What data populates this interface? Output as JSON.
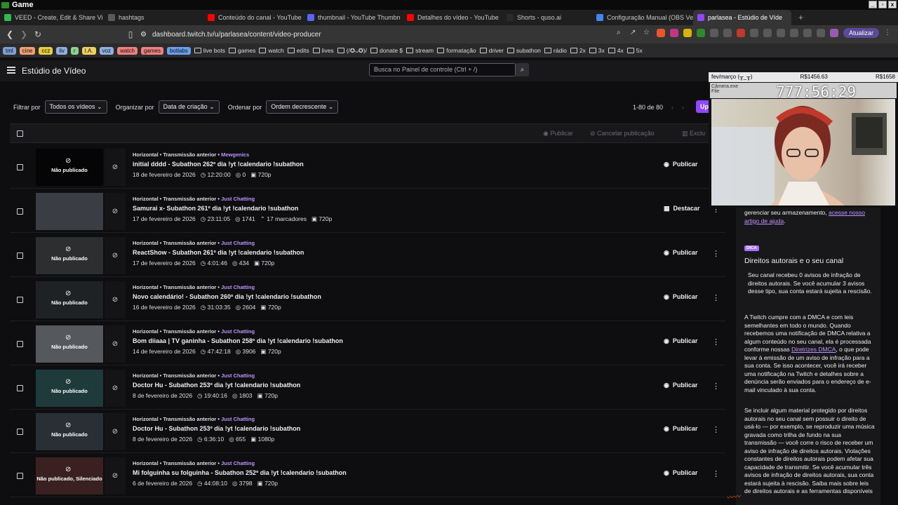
{
  "os": {
    "title": "Game"
  },
  "browser": {
    "tabs": [
      {
        "label": "VEED - Create, Edit & Share Vi",
        "color": "#2dbb4e"
      },
      {
        "label": "hashtags",
        "color": "#5a5a5a"
      },
      {
        "label": "Conteúdo do canal - YouTube",
        "color": "#ff0000"
      },
      {
        "label": "thumbnail - YouTube Thumbn",
        "color": "#5865f2"
      },
      {
        "label": "Detalhes do vídeo - YouTube",
        "color": "#ff0000"
      },
      {
        "label": "Shorts - quso.ai",
        "color": "#2a2a2a"
      },
      {
        "label": "Configuração Manual (OBS Ve",
        "color": "#4285f4"
      },
      {
        "label": "parlasea - Estúdio de Víde",
        "color": "#9147ff"
      }
    ],
    "url": "dashboard.twitch.tv/u/parlasea/content/video-producer",
    "update_label": "Atualizar",
    "bookmarks": [
      {
        "label": "tml",
        "color": "#7d9fd6"
      },
      {
        "label": "cine",
        "color": "#f0a070"
      },
      {
        "label": "ccz",
        "color": "#e8cc40"
      },
      {
        "label": "liv",
        "color": "#8db0e0"
      },
      {
        "label": "r",
        "color": "#8fd08f"
      },
      {
        "label": "I.A.",
        "color": "#f0d060"
      },
      {
        "label": "voz",
        "color": "#8fb0e0"
      },
      {
        "label": "watch",
        "color": "#f08080"
      },
      {
        "label": "games",
        "color": "#f08080"
      },
      {
        "label": "botlabs",
        "color": "#6aa0f0"
      }
    ],
    "folders": [
      "live bots",
      "games",
      "watch",
      "edits",
      "lives",
      "(/✪ᴗ✪)/",
      "donate $",
      "stream",
      "formatação",
      "driver",
      "subathon",
      "rádio",
      "2x",
      "3x",
      "4x",
      "5x"
    ]
  },
  "studio": {
    "title": "Estúdio de Vídeo",
    "search_placeholder": "Busca no Painel de controle (Ctrl + /)",
    "filter_label": "Filtrar por",
    "filter_value": "Todos os vídeos",
    "organize_label": "Organizar por",
    "organize_value": "Data de criação",
    "order_label": "Ordenar por",
    "order_value": "Ordem decrescente",
    "pager": "1-80 de 80",
    "upload_label": "Upl",
    "bulk_publish": "Publicar",
    "bulk_unpublish": "Cancelar publicação",
    "bulk_delete": "Exclu"
  },
  "videos": [
    {
      "meta": "Horizontal • Transmissão anterior • ",
      "game": "Mewgenics",
      "title": "initial dddd - Subathon 262º dia !yt !calendario !subathon",
      "date": "18 de fevereiro de 2026",
      "duration": "12:20:00",
      "views": "0",
      "markers": "",
      "quality": "720p",
      "status": "Não publicado",
      "action": "Publicar"
    },
    {
      "meta": "Horizontal • Transmissão anterior • ",
      "game": "Just Chatting",
      "title": "Samurai x- Subathon 261º dia !yt !calendario !subathon",
      "date": "17 de fevereiro de 2026",
      "duration": "23:11:05",
      "views": "1741",
      "markers": "17 marcadores",
      "quality": "720p",
      "status": "",
      "action": "Destacar"
    },
    {
      "meta": "Horizontal • Transmissão anterior • ",
      "game": "Just Chatting",
      "title": "ReactShow - Subathon 261º dia !yt !calendario !subathon",
      "date": "17 de fevereiro de 2026",
      "duration": "4:01:46",
      "views": "434",
      "markers": "",
      "quality": "720p",
      "status": "Não publicado",
      "action": "Publicar"
    },
    {
      "meta": "Horizontal • Transmissão anterior • ",
      "game": "Just Chatting",
      "title": "Novo calendário! - Subathon 260º dia !yt !calendario !subathon",
      "date": "16 de fevereiro de 2026",
      "duration": "31:03:35",
      "views": "2604",
      "markers": "",
      "quality": "720p",
      "status": "Não publicado",
      "action": "Publicar"
    },
    {
      "meta": "Horizontal • Transmissão anterior • ",
      "game": "Just Chatting",
      "title": "Bom diiaaa | TV ganinha - Subathon 258º dia !yt !calendario !subathon",
      "date": "14 de fevereiro de 2026",
      "duration": "47:42:18",
      "views": "3906",
      "markers": "",
      "quality": "720p",
      "status": "Não publicado",
      "action": "Publicar"
    },
    {
      "meta": "Horizontal • Transmissão anterior • ",
      "game": "Just Chatting",
      "title": "Doctor Hu - Subathon 253º dia !yt !calendario !subathon",
      "date": "8 de fevereiro de 2026",
      "duration": "19:40:16",
      "views": "1803",
      "markers": "",
      "quality": "720p",
      "status": "Não publicado",
      "action": "Publicar"
    },
    {
      "meta": "Horizontal • Transmissão anterior • ",
      "game": "Just Chatting",
      "title": "Doctor Hu - Subathon 253º dia !yt !calendario !subathon",
      "date": "8 de fevereiro de 2026",
      "duration": "6:36:10",
      "views": "655",
      "markers": "",
      "quality": "1080p",
      "status": "Não publicado",
      "action": "Publicar"
    },
    {
      "meta": "Horizontal • Transmissão anterior • ",
      "game": "Just Chatting",
      "title": "Mi folguinha su folguinha - Subathon 252º dia !yt !calendario !subathon",
      "date": "6 de fevereiro de 2026",
      "duration": "44:08:10",
      "views": "3798",
      "markers": "",
      "quality": "720p",
      "status": "Não publicado, Silenciado",
      "action": "Publicar"
    }
  ],
  "panel": {
    "storage_text": "gerenciar seu armazenamento, ",
    "storage_link": "acesse nosso artigo de ajuda",
    "badge": "DICA",
    "heading": "Direitos autorais e o seu canal",
    "p1": "Seu canal recebeu 0 avisos de infração de direitos autorais. Se você acumular 3 avisos desse tipo, sua conta estará sujeita a rescisão.",
    "p2a": "A Twitch cumpre com a DMCA e com leis semelhantes em todo o mundo. Quando recebemos uma notificação de DMCA relativa a algum conteúdo no seu canal, ela é processada conforme nossas ",
    "p2link": "Diretrizes DMCA",
    "p2b": ", o que pode levar à emissão de um aviso de infração para a sua conta. Se isso acontecer, você irá receber uma notificação na Twitch e detalhes sobre a denúncia serão enviados para o endereço de e-mail vinculado à sua conta.",
    "p3": "Se incluir algum material protegido por direitos autorais no seu canal sem possuir o direito de usá-lo — por exemplo, se reproduzir uma música gravada como trilha de fundo na sua transmissão — você corre o risco de receber um aviso de infração de direitos autorais. Violações constantes de direitos autorais podem afetar sua capacidade de transmitir. Se você acumular três avisos de infração de direitos autorais, sua conta estará sujeita à rescisão. Saiba mais sobre leis de direitos autorais e as ferramentas disponíveis"
  },
  "overlay": {
    "title": "fev/março  (╥_╥)",
    "amount1": "R$1456.63",
    "amount2": "R$1658",
    "window_label": "Câmera.exe",
    "file_menu": "File",
    "timer": "777:56:29"
  }
}
